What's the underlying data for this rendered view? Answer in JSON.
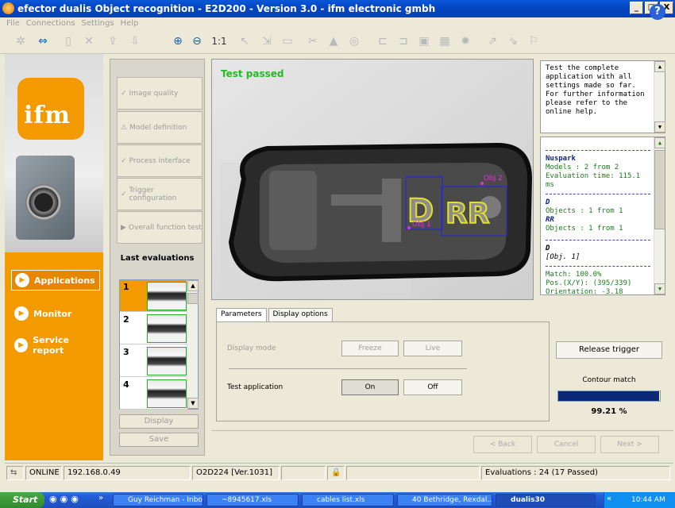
{
  "window": {
    "title": "efector dualis Object recognition - E2D200 - Version 3.0 - ifm electronic gmbh",
    "min": "_",
    "max": "□",
    "close": "X"
  },
  "menu": [
    "File",
    "Connections",
    "Settings",
    "Help"
  ],
  "toolbar": {
    "zoom_label": "1:1",
    "help": "?"
  },
  "brand": {
    "logo": "ifm"
  },
  "nav": [
    {
      "label": "Applications"
    },
    {
      "label": "Monitor"
    },
    {
      "label": "Service report"
    }
  ],
  "steps": [
    {
      "icon": "✓",
      "label": "Image quality"
    },
    {
      "icon": "⚠",
      "label": "Model definition"
    },
    {
      "icon": "✓",
      "label": "Process interface"
    },
    {
      "icon": "✓",
      "label": "Trigger configuration"
    },
    {
      "icon": "▶",
      "label": "Overall function test"
    }
  ],
  "last_evaluations": {
    "title": "Last evaluations",
    "items": [
      "1",
      "2",
      "3",
      "4"
    ],
    "display_btn": "Display",
    "save_btn": "Save"
  },
  "viewer": {
    "status": "Test passed",
    "obj2": "Obj 2",
    "obj1": "Obj 1"
  },
  "info_top": "Test the complete application with all settings made so far. For further information please refer to the online help.",
  "info_bottom": {
    "app_name": "Nuspark",
    "models": "Models : 2 from 2",
    "eval_time": "Evaluation time: 115.1 ms",
    "model_d": "D",
    "objects_d": "Objects : 1 from 1",
    "model_rr": "RR",
    "objects_rr": "Objects : 1 from 1",
    "detail_model": "D",
    "detail_obj": "[Obj. 1]",
    "match": "Match: 100.0%",
    "pos": "Pos.(X/Y): (395/339)",
    "orientation": "Orientation: -3.18 degree"
  },
  "params": {
    "tab_parameters": "Parameters",
    "tab_display": "Display options",
    "display_mode_label": "Display mode",
    "freeze": "Freeze",
    "live": "Live",
    "test_app_label": "Test application",
    "on": "On",
    "off": "Off"
  },
  "right_controls": {
    "release_trigger": "Release trigger",
    "contour_label": "Contour match",
    "contour_value": "99.21 %",
    "contour_fraction": 0.9921
  },
  "wizard": {
    "back": "< Back",
    "cancel": "Cancel",
    "next": "Next >"
  },
  "status": {
    "online": "ONLINE",
    "ip": "192.168.0.49",
    "device": "O2D224 [Ver.1031]",
    "evaluations": "Evaluations : 24 (17 Passed)"
  },
  "taskbar": {
    "start": "Start",
    "quick": "»",
    "tasks": [
      "Guy Reichman - Inbo...",
      "~8945617.xls",
      "cables list.xls",
      "40 Bethridge, Rexdal...",
      "dualis30"
    ],
    "tray_more": "«",
    "time": "10:44 AM"
  },
  "colors": {
    "accent": "#f39a00",
    "pass": "#22bb22",
    "title_blue": "#0346c4"
  }
}
